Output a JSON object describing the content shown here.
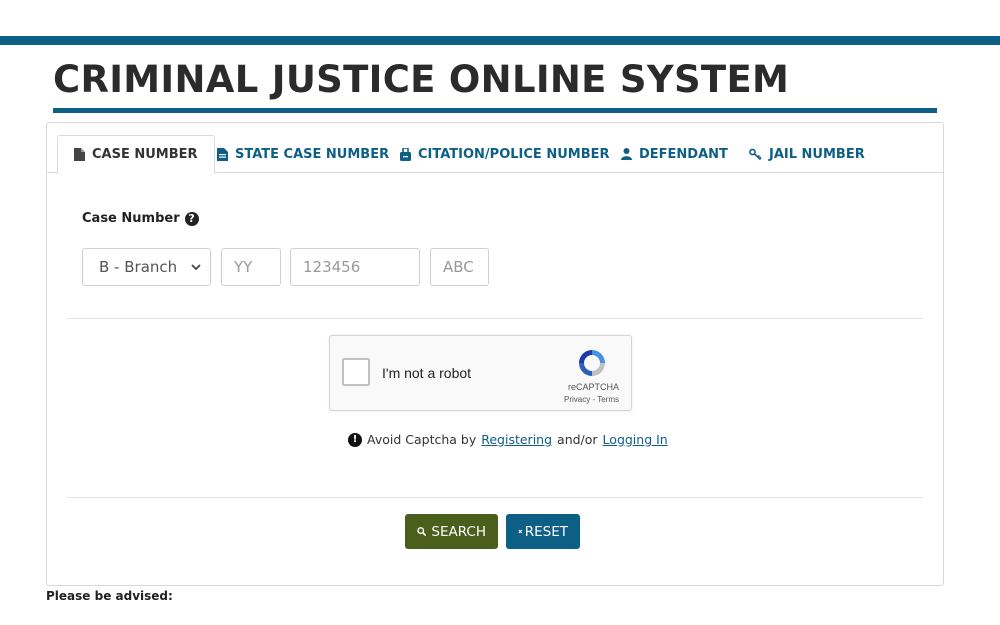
{
  "header": {
    "title": "CRIMINAL JUSTICE ONLINE SYSTEM"
  },
  "tabs": [
    {
      "label": "CASE NUMBER",
      "icon": "file-icon",
      "active": true
    },
    {
      "label": "STATE CASE NUMBER",
      "icon": "file-text-icon",
      "active": false
    },
    {
      "label": "CITATION/POLICE NUMBER",
      "icon": "badge-icon",
      "active": false
    },
    {
      "label": "DEFENDANT",
      "icon": "user-icon",
      "active": false
    },
    {
      "label": "JAIL NUMBER",
      "icon": "key-icon",
      "active": false
    }
  ],
  "form": {
    "case_number_label": "Case Number",
    "branch_select": {
      "value": "B - Branch"
    },
    "year_placeholder": "YY",
    "number_placeholder": "123456",
    "suffix_placeholder": "ABC"
  },
  "captcha": {
    "text": "I'm not a robot",
    "brand": "reCAPTCHA",
    "links": "Privacy - Terms"
  },
  "notice": {
    "prefix": "Avoid Captcha by",
    "register_link": "Registering",
    "middle": "and/or",
    "login_link": "Logging In"
  },
  "buttons": {
    "search": "SEARCH",
    "reset": "RESET"
  },
  "footer": {
    "advised": "Please be advised:"
  },
  "colors": {
    "brand": "#0e5f85",
    "search_button": "#4a5f1b",
    "reset_button": "#0e5f85"
  }
}
